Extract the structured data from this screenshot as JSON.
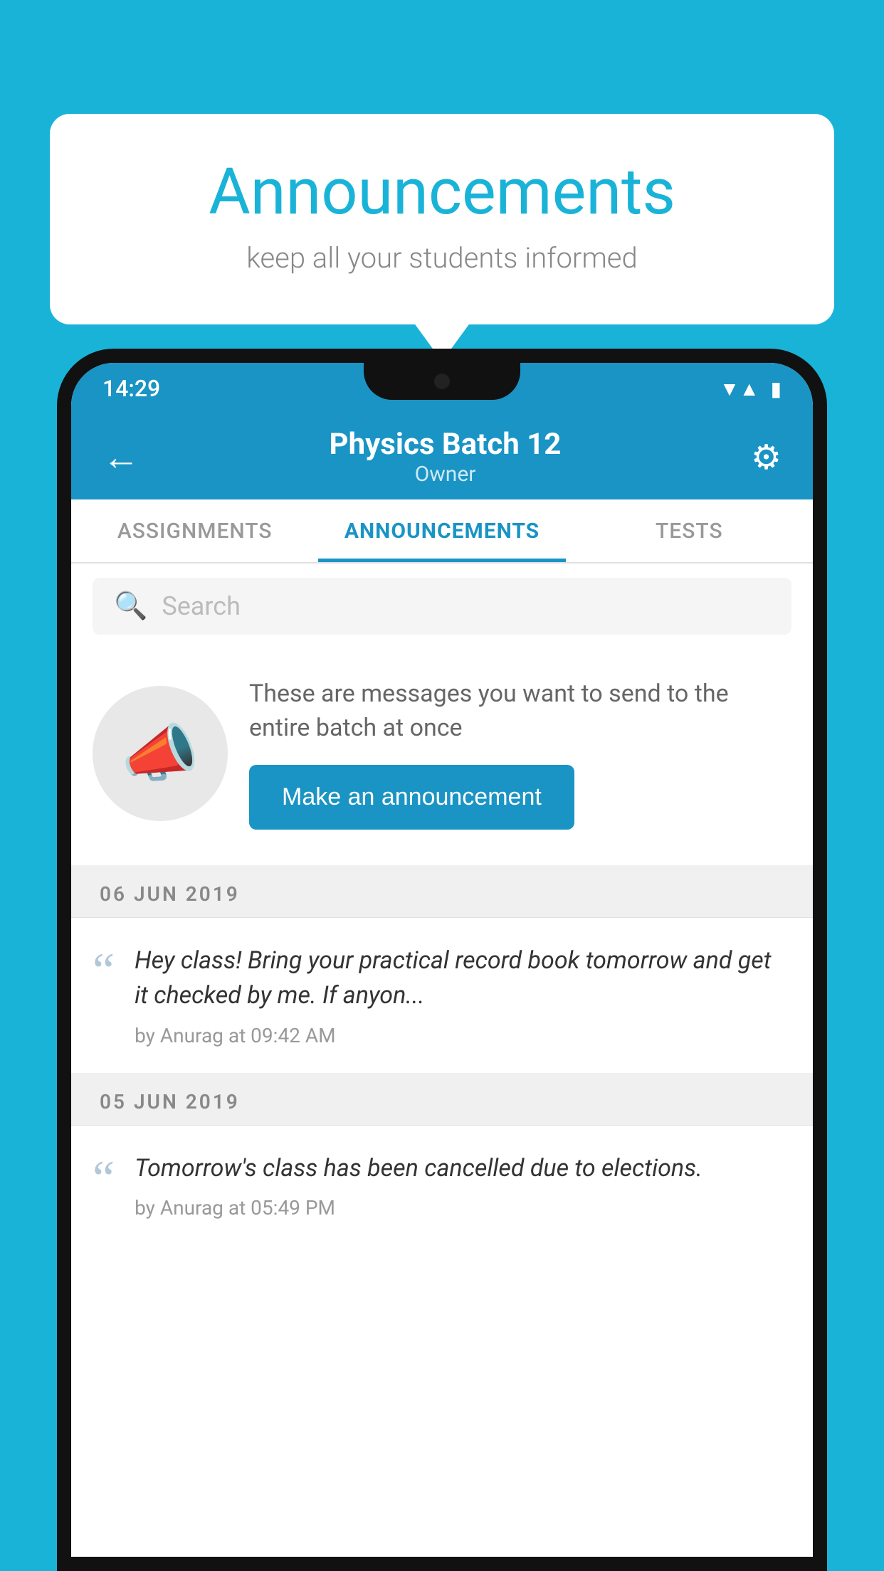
{
  "background_color": "#1ab3d8",
  "bubble": {
    "title": "Announcements",
    "subtitle": "keep all your students informed"
  },
  "phone": {
    "status_bar": {
      "time": "14:29",
      "wifi": "▼",
      "signal": "▲",
      "battery": "▮"
    },
    "app_bar": {
      "back_label": "←",
      "title": "Physics Batch 12",
      "subtitle": "Owner",
      "gear_label": "⚙"
    },
    "tabs": [
      {
        "label": "ASSIGNMENTS",
        "active": false
      },
      {
        "label": "ANNOUNCEMENTS",
        "active": true
      },
      {
        "label": "TESTS",
        "active": false
      }
    ],
    "search": {
      "placeholder": "Search"
    },
    "intro": {
      "description_text": "These are messages you want to send to the entire batch at once",
      "button_label": "Make an announcement"
    },
    "announcements": [
      {
        "date": "06  JUN  2019",
        "message": "Hey class! Bring your practical record book tomorrow and get it checked by me. If anyon...",
        "author": "by Anurag at 09:42 AM"
      },
      {
        "date": "05  JUN  2019",
        "message": "Tomorrow's class has been cancelled due to elections.",
        "author": "by Anurag at 05:49 PM"
      }
    ]
  }
}
